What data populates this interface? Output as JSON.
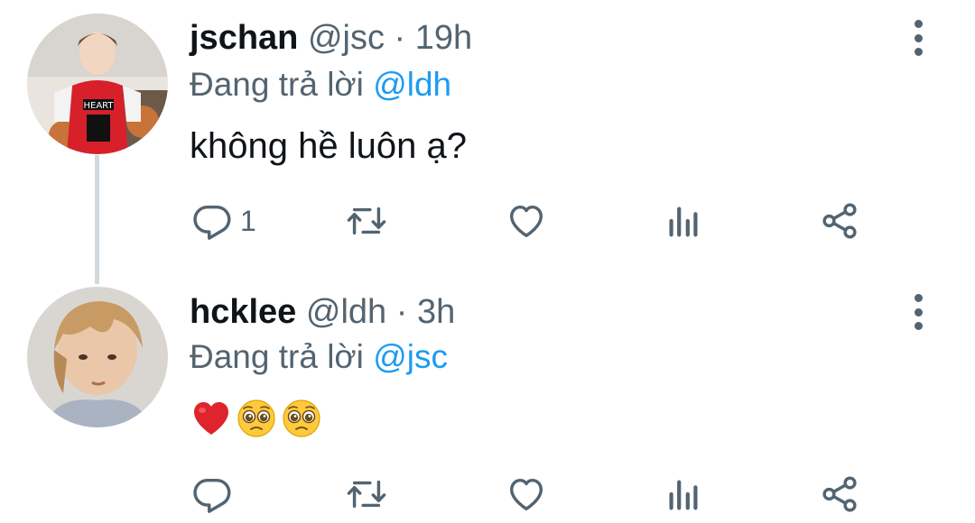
{
  "tweets": [
    {
      "display_name": "jschan",
      "handle": "@jsc",
      "separator": "·",
      "time": "19h",
      "reply_prefix": "Đang trả lời",
      "reply_to": "@ldh",
      "text": "không hề luôn ạ?",
      "actions": {
        "reply_count": "1"
      }
    },
    {
      "display_name": "hcklee",
      "handle": "@ldh",
      "separator": "·",
      "time": "3h",
      "reply_prefix": "Đang trả lời",
      "reply_to": "@jsc",
      "emojis": [
        "heart-emoji",
        "pleading-face-emoji",
        "pleading-face-emoji"
      ],
      "actions": {
        "reply_count": ""
      }
    }
  ],
  "colors": {
    "text_primary": "#0f1419",
    "text_secondary": "#536471",
    "mention": "#1d9bf0",
    "thread_line": "#cfd9de"
  }
}
